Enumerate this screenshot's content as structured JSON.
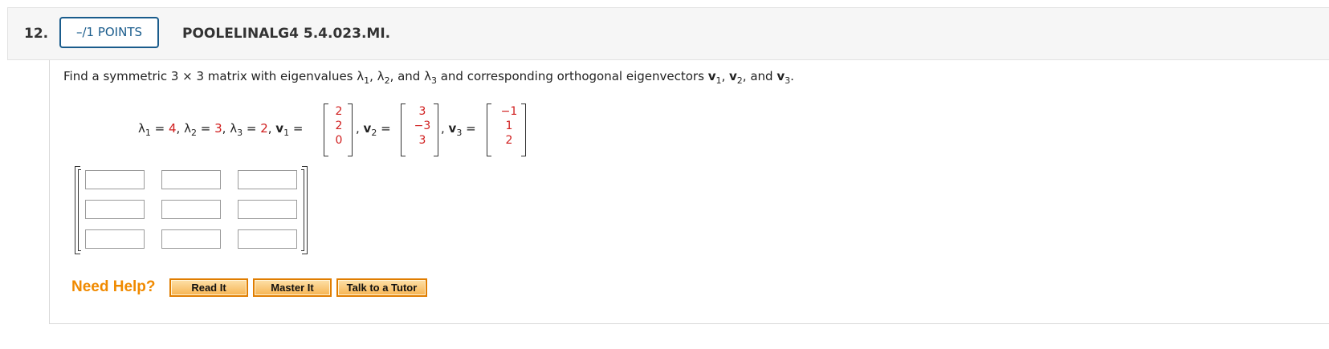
{
  "header": {
    "question_number": "12.",
    "points_label": "–/1 POINTS",
    "question_id": "POOLELINALG4 5.4.023.MI."
  },
  "prompt": {
    "p1": "Find a symmetric 3 × 3 matrix with eigenvalues λ",
    "s1": "1",
    "p2": ", λ",
    "s2": "2",
    "p3": ", and λ",
    "s3": "3",
    "p4": " and corresponding orthogonal eigenvectors ",
    "v1": "v",
    "vs1": "1",
    "p5": ", ",
    "v2": "v",
    "vs2": "2",
    "p6": ", and ",
    "v3": "v",
    "vs3": "3",
    "p7": "."
  },
  "given": {
    "lambda": "λ",
    "sub1": "1",
    "sub2": "2",
    "sub3": "3",
    "eq": " = ",
    "comma": ", ",
    "lambda1_value": "4",
    "lambda2_value": "3",
    "lambda3_value": "2",
    "v": "v",
    "v1": [
      "2",
      "2",
      "0"
    ],
    "v2": [
      "3",
      "−3",
      "3"
    ],
    "v3": [
      "−1",
      "1",
      "2"
    ]
  },
  "answer_matrix": {
    "rows": [
      [
        "",
        "",
        ""
      ],
      [
        "",
        "",
        ""
      ],
      [
        "",
        "",
        ""
      ]
    ]
  },
  "help": {
    "label": "Need Help?",
    "buttons": [
      "Read It",
      "Master It",
      "Talk to a Tutor"
    ]
  },
  "colors": {
    "value_red": "#d01d1d",
    "help_orange": "#f08a00",
    "points_blue": "#1a5c8c"
  }
}
